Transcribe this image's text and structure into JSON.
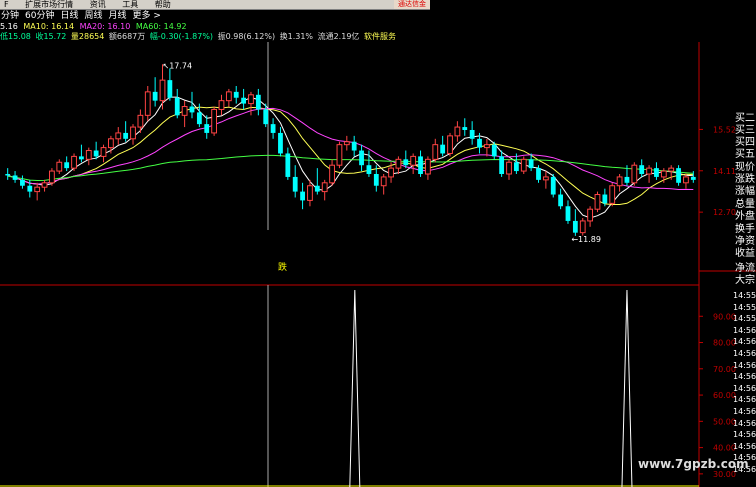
{
  "menu": {
    "items": [
      "F",
      "扩展市场行情",
      "资讯",
      "工具",
      "帮助"
    ],
    "ad": "通达信金"
  },
  "tabs": [
    "分钟",
    "60分钟",
    "日线",
    "周线",
    "月线",
    "更多 >"
  ],
  "ma_line": {
    "ma5": "5.16",
    "ma10": "MA10: 16.14",
    "ma20": "MA20: 16.10",
    "ma60": "MA60: 14.92"
  },
  "info_line": {
    "low": "低15.08",
    "close": "收15.72",
    "vol": "量28654",
    "amount": "额6687万",
    "change": "幅-0.30(-1.87%)",
    "amplitude": "振0.98(6.12%)",
    "turnover": "换1.31%",
    "float": "流通2.19亿",
    "sector": "软件服务"
  },
  "colors": {
    "ma5": "#ffffff",
    "ma10": "#ffff55",
    "ma20": "#ff44ff",
    "ma60": "#44ff44",
    "up": "#ff4444",
    "down": "#00ffff",
    "axis": "#c00000",
    "sub_line": "#ffffff",
    "sub_baseline": "#ffff00"
  },
  "side_panel": [
    "买二",
    "买三",
    "买四",
    "买五",
    "现价",
    "涨跌",
    "涨幅",
    "总量",
    "外盘",
    "换手",
    "净资",
    "收益",
    "净流",
    "大宗"
  ],
  "time_ticks": [
    "14:55",
    "14:55",
    "14:55",
    "14:56",
    "14:56",
    "14:56",
    "14:56",
    "14:56",
    "14:56",
    "14:56",
    "14:56",
    "14:56",
    "14:56",
    "14:56",
    "14:56",
    "14:56"
  ],
  "sub_signal_label": "跌",
  "watermark": "www.7gpzb.com",
  "chart_data": [
    {
      "type": "candlestick",
      "ylim": [
        11.0,
        18.5
      ],
      "y_ticks": [
        "15.52",
        "14.11",
        "12.70"
      ],
      "annotations": [
        {
          "label": "17.74",
          "value": 17.74
        },
        {
          "label": "11.89",
          "value": 11.89
        }
      ],
      "candles": [
        {
          "o": 14.0,
          "h": 14.2,
          "l": 13.8,
          "c": 13.95
        },
        {
          "o": 13.95,
          "h": 14.1,
          "l": 13.7,
          "c": 13.8
        },
        {
          "o": 13.8,
          "h": 13.95,
          "l": 13.5,
          "c": 13.6
        },
        {
          "o": 13.6,
          "h": 13.8,
          "l": 13.2,
          "c": 13.4
        },
        {
          "o": 13.4,
          "h": 13.7,
          "l": 13.1,
          "c": 13.55
        },
        {
          "o": 13.55,
          "h": 13.8,
          "l": 13.4,
          "c": 13.7
        },
        {
          "o": 13.7,
          "h": 14.2,
          "l": 13.6,
          "c": 14.1
        },
        {
          "o": 14.1,
          "h": 14.5,
          "l": 14.0,
          "c": 14.4
        },
        {
          "o": 14.4,
          "h": 14.6,
          "l": 14.1,
          "c": 14.2
        },
        {
          "o": 14.2,
          "h": 14.7,
          "l": 14.1,
          "c": 14.6
        },
        {
          "o": 14.6,
          "h": 15.0,
          "l": 14.4,
          "c": 14.5
        },
        {
          "o": 14.5,
          "h": 14.9,
          "l": 14.3,
          "c": 14.8
        },
        {
          "o": 14.8,
          "h": 15.1,
          "l": 14.5,
          "c": 14.6
        },
        {
          "o": 14.6,
          "h": 15.0,
          "l": 14.4,
          "c": 14.9
        },
        {
          "o": 14.9,
          "h": 15.3,
          "l": 14.7,
          "c": 15.2
        },
        {
          "o": 15.2,
          "h": 15.6,
          "l": 15.0,
          "c": 15.4
        },
        {
          "o": 15.4,
          "h": 15.8,
          "l": 15.1,
          "c": 15.2
        },
        {
          "o": 15.2,
          "h": 15.7,
          "l": 15.0,
          "c": 15.6
        },
        {
          "o": 15.6,
          "h": 16.2,
          "l": 15.4,
          "c": 16.0
        },
        {
          "o": 16.0,
          "h": 17.0,
          "l": 15.8,
          "c": 16.8
        },
        {
          "o": 16.8,
          "h": 17.3,
          "l": 16.3,
          "c": 16.5
        },
        {
          "o": 16.5,
          "h": 17.74,
          "l": 16.2,
          "c": 17.2
        },
        {
          "o": 17.2,
          "h": 17.6,
          "l": 16.5,
          "c": 16.6
        },
        {
          "o": 16.6,
          "h": 16.9,
          "l": 15.9,
          "c": 16.0
        },
        {
          "o": 16.0,
          "h": 16.5,
          "l": 15.6,
          "c": 16.3
        },
        {
          "o": 16.3,
          "h": 16.8,
          "l": 15.9,
          "c": 16.1
        },
        {
          "o": 16.1,
          "h": 16.4,
          "l": 15.6,
          "c": 15.7
        },
        {
          "o": 15.7,
          "h": 16.0,
          "l": 15.2,
          "c": 15.4
        },
        {
          "o": 15.4,
          "h": 16.3,
          "l": 15.3,
          "c": 16.2
        },
        {
          "o": 16.2,
          "h": 16.7,
          "l": 16.0,
          "c": 16.5
        },
        {
          "o": 16.5,
          "h": 16.9,
          "l": 16.3,
          "c": 16.8
        },
        {
          "o": 16.8,
          "h": 17.0,
          "l": 16.4,
          "c": 16.6
        },
        {
          "o": 16.6,
          "h": 16.9,
          "l": 16.2,
          "c": 16.4
        },
        {
          "o": 16.4,
          "h": 16.8,
          "l": 16.0,
          "c": 16.7
        },
        {
          "o": 16.7,
          "h": 16.9,
          "l": 16.0,
          "c": 16.2
        },
        {
          "o": 16.2,
          "h": 16.4,
          "l": 15.6,
          "c": 15.7
        },
        {
          "o": 15.7,
          "h": 15.9,
          "l": 15.2,
          "c": 15.4
        },
        {
          "o": 15.4,
          "h": 15.6,
          "l": 14.6,
          "c": 14.7
        },
        {
          "o": 14.7,
          "h": 14.9,
          "l": 13.8,
          "c": 13.9
        },
        {
          "o": 13.9,
          "h": 14.3,
          "l": 13.2,
          "c": 13.4
        },
        {
          "o": 13.4,
          "h": 13.7,
          "l": 12.8,
          "c": 13.1
        },
        {
          "o": 13.1,
          "h": 13.8,
          "l": 12.9,
          "c": 13.6
        },
        {
          "o": 13.6,
          "h": 14.2,
          "l": 13.3,
          "c": 13.4
        },
        {
          "o": 13.4,
          "h": 13.8,
          "l": 13.1,
          "c": 13.7
        },
        {
          "o": 13.7,
          "h": 14.5,
          "l": 13.6,
          "c": 14.3
        },
        {
          "o": 14.3,
          "h": 15.1,
          "l": 14.2,
          "c": 15.0
        },
        {
          "o": 15.0,
          "h": 15.3,
          "l": 14.8,
          "c": 15.1
        },
        {
          "o": 15.1,
          "h": 15.3,
          "l": 14.6,
          "c": 14.8
        },
        {
          "o": 14.8,
          "h": 15.0,
          "l": 14.1,
          "c": 14.3
        },
        {
          "o": 14.3,
          "h": 14.8,
          "l": 13.9,
          "c": 14.0
        },
        {
          "o": 14.0,
          "h": 14.3,
          "l": 13.4,
          "c": 13.6
        },
        {
          "o": 13.6,
          "h": 14.0,
          "l": 13.3,
          "c": 13.9
        },
        {
          "o": 13.9,
          "h": 14.4,
          "l": 13.7,
          "c": 14.2
        },
        {
          "o": 14.2,
          "h": 14.6,
          "l": 14.0,
          "c": 14.5
        },
        {
          "o": 14.5,
          "h": 14.8,
          "l": 14.2,
          "c": 14.3
        },
        {
          "o": 14.3,
          "h": 14.7,
          "l": 14.0,
          "c": 14.6
        },
        {
          "o": 14.6,
          "h": 14.8,
          "l": 13.9,
          "c": 14.0
        },
        {
          "o": 14.0,
          "h": 14.6,
          "l": 13.8,
          "c": 14.5
        },
        {
          "o": 14.5,
          "h": 15.2,
          "l": 14.4,
          "c": 15.0
        },
        {
          "o": 15.0,
          "h": 15.3,
          "l": 14.6,
          "c": 14.7
        },
        {
          "o": 14.7,
          "h": 15.4,
          "l": 14.6,
          "c": 15.3
        },
        {
          "o": 15.3,
          "h": 15.8,
          "l": 15.1,
          "c": 15.6
        },
        {
          "o": 15.6,
          "h": 15.9,
          "l": 15.3,
          "c": 15.5
        },
        {
          "o": 15.5,
          "h": 15.8,
          "l": 15.0,
          "c": 15.2
        },
        {
          "o": 15.2,
          "h": 15.4,
          "l": 14.7,
          "c": 14.9
        },
        {
          "o": 14.9,
          "h": 15.2,
          "l": 14.6,
          "c": 15.0
        },
        {
          "o": 15.0,
          "h": 15.1,
          "l": 14.5,
          "c": 14.6
        },
        {
          "o": 14.6,
          "h": 14.8,
          "l": 13.9,
          "c": 14.0
        },
        {
          "o": 14.0,
          "h": 14.5,
          "l": 13.8,
          "c": 14.4
        },
        {
          "o": 14.4,
          "h": 14.7,
          "l": 14.0,
          "c": 14.1
        },
        {
          "o": 14.1,
          "h": 14.6,
          "l": 14.0,
          "c": 14.5
        },
        {
          "o": 14.5,
          "h": 14.7,
          "l": 14.1,
          "c": 14.2
        },
        {
          "o": 14.2,
          "h": 14.3,
          "l": 13.7,
          "c": 13.8
        },
        {
          "o": 13.8,
          "h": 14.1,
          "l": 13.5,
          "c": 13.9
        },
        {
          "o": 13.9,
          "h": 14.0,
          "l": 13.2,
          "c": 13.3
        },
        {
          "o": 13.3,
          "h": 13.5,
          "l": 12.8,
          "c": 12.9
        },
        {
          "o": 12.9,
          "h": 13.1,
          "l": 12.3,
          "c": 12.4
        },
        {
          "o": 12.4,
          "h": 12.8,
          "l": 11.89,
          "c": 12.0
        },
        {
          "o": 12.0,
          "h": 12.5,
          "l": 11.9,
          "c": 12.4
        },
        {
          "o": 12.4,
          "h": 12.9,
          "l": 12.2,
          "c": 12.8
        },
        {
          "o": 12.8,
          "h": 13.4,
          "l": 12.7,
          "c": 13.3
        },
        {
          "o": 13.3,
          "h": 13.5,
          "l": 12.9,
          "c": 13.0
        },
        {
          "o": 13.0,
          "h": 13.7,
          "l": 12.9,
          "c": 13.6
        },
        {
          "o": 13.6,
          "h": 14.0,
          "l": 13.4,
          "c": 13.9
        },
        {
          "o": 13.9,
          "h": 14.3,
          "l": 13.6,
          "c": 13.7
        },
        {
          "o": 13.7,
          "h": 14.4,
          "l": 13.6,
          "c": 14.3
        },
        {
          "o": 14.3,
          "h": 14.5,
          "l": 13.9,
          "c": 14.0
        },
        {
          "o": 14.0,
          "h": 14.3,
          "l": 13.7,
          "c": 14.2
        },
        {
          "o": 14.2,
          "h": 14.4,
          "l": 13.8,
          "c": 13.9
        },
        {
          "o": 13.9,
          "h": 14.2,
          "l": 13.7,
          "c": 14.1
        },
        {
          "o": 14.1,
          "h": 14.3,
          "l": 13.8,
          "c": 14.2
        },
        {
          "o": 14.2,
          "h": 14.3,
          "l": 13.6,
          "c": 13.7
        },
        {
          "o": 13.7,
          "h": 14.0,
          "l": 13.5,
          "c": 13.9
        },
        {
          "o": 13.9,
          "h": 14.1,
          "l": 13.7,
          "c": 13.8
        }
      ],
      "ma_windows": [
        5,
        10,
        20,
        60
      ]
    },
    {
      "type": "line",
      "ylim": [
        25,
        100
      ],
      "y_ticks": [
        "90.00",
        "80.00",
        "70.00",
        "60.00",
        "50.00",
        "40.00",
        "30.00"
      ],
      "spikes": [
        {
          "index": 46,
          "value": 100
        },
        {
          "index": 84,
          "value": 100
        }
      ],
      "baseline": 25,
      "series": []
    }
  ]
}
